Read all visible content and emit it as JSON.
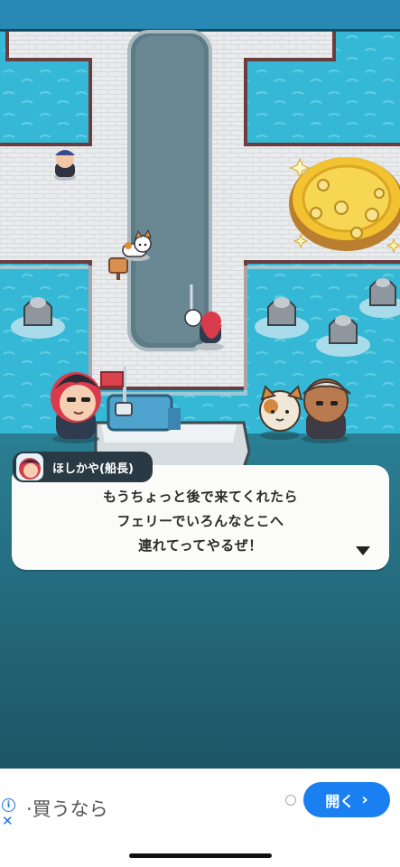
{
  "dialog": {
    "speaker": "ほしかや(船長)",
    "lines": [
      "もうちょっと後で来てくれたら",
      "フェリーでいろんなとこへ",
      "連れてってやるぜ！"
    ]
  },
  "ad": {
    "text": "·買うなら",
    "button_label": "開く",
    "info_icon": "info-icon",
    "close_icon": "close-icon"
  },
  "colors": {
    "water": "#35b8d6",
    "pier": "#e8eaec",
    "dialog_bg": "#fbfbf9",
    "ad_button": "#1a7ff0",
    "lower_bg": "#1f5f71"
  }
}
